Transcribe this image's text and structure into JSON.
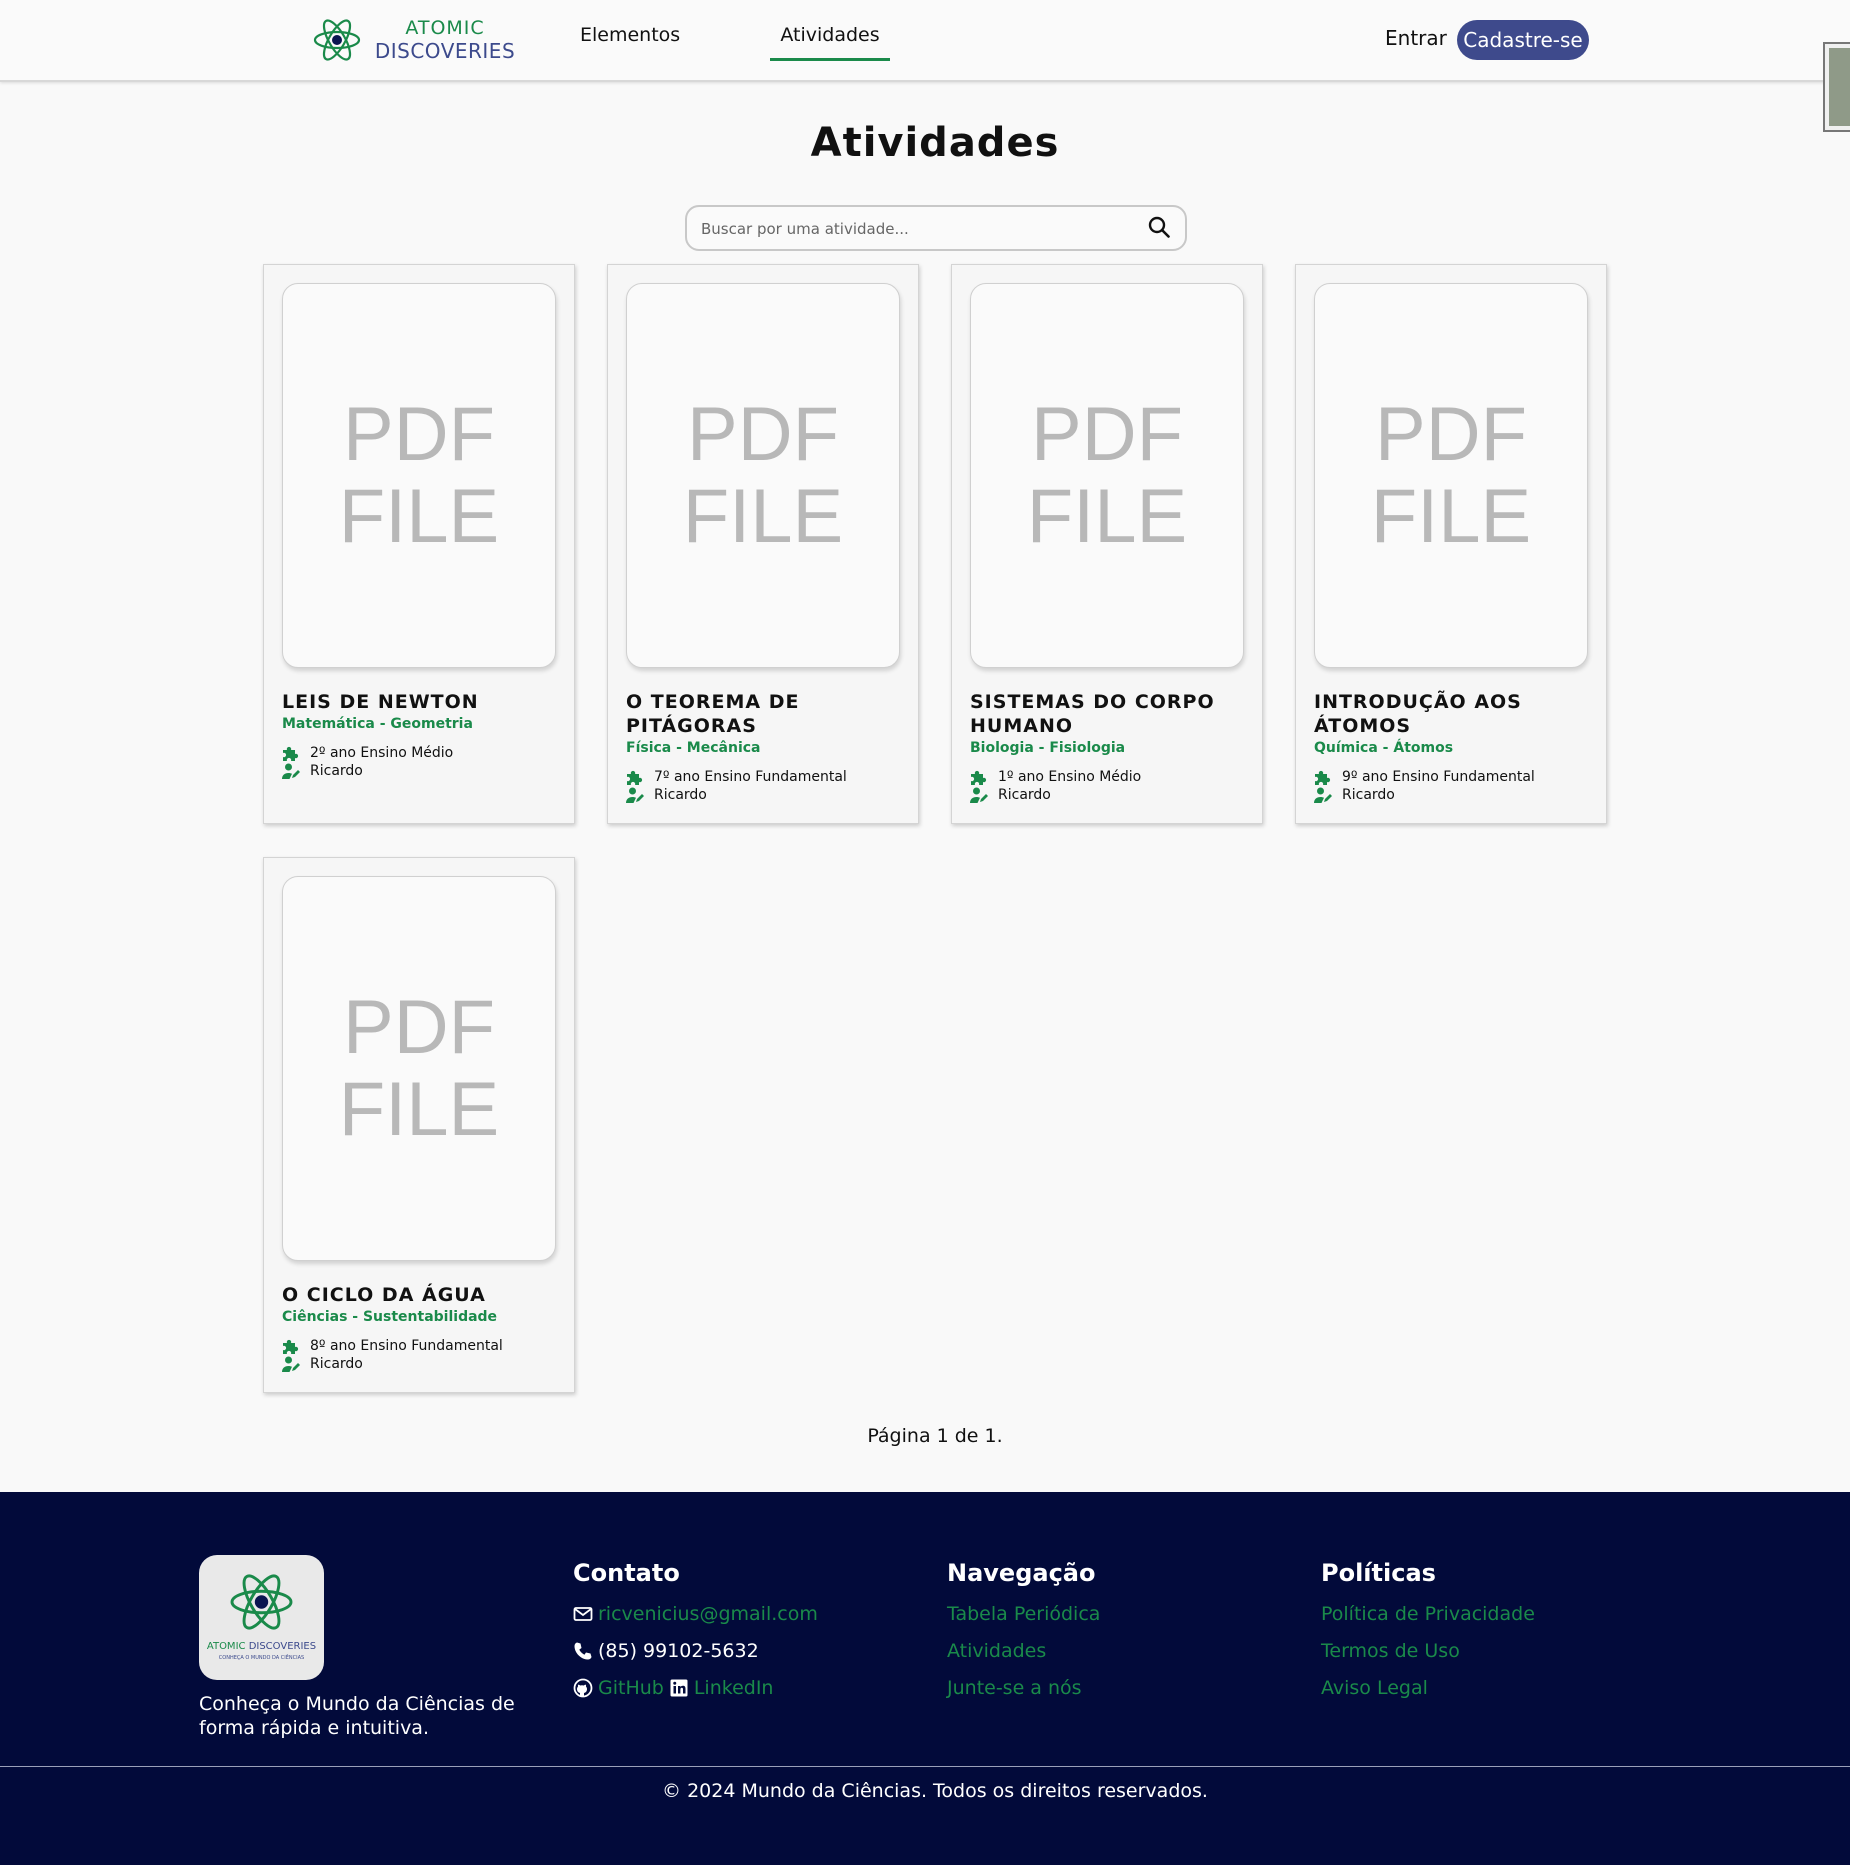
{
  "header": {
    "logo_line1": "ATOMIC",
    "logo_line2": "DISCOVERIES",
    "nav": [
      "Elementos",
      "Atividades"
    ],
    "login_label": "Entrar",
    "signup_label": "Cadastre-se"
  },
  "page": {
    "title": "Atividades",
    "search_placeholder": "Buscar por uma atividade...",
    "pagination": "Página 1 de 1."
  },
  "cards": [
    {
      "thumb_line1": "PDF",
      "thumb_line2": "FILE",
      "title": "LEIS DE NEWTON",
      "subject": "Matemática - Geometria",
      "grade": "2º ano Ensino Médio",
      "author": "Ricardo"
    },
    {
      "thumb_line1": "PDF",
      "thumb_line2": "FILE",
      "title": "O TEOREMA DE PITÁGORAS",
      "subject": "Física - Mecânica",
      "grade": "7º ano Ensino Fundamental",
      "author": "Ricardo"
    },
    {
      "thumb_line1": "PDF",
      "thumb_line2": "FILE",
      "title": "SISTEMAS DO CORPO HUMANO",
      "subject": "Biologia - Fisiologia",
      "grade": "1º ano Ensino Médio",
      "author": "Ricardo"
    },
    {
      "thumb_line1": "PDF",
      "thumb_line2": "FILE",
      "title": "INTRODUÇÃO AOS ÁTOMOS",
      "subject": "Química - Átomos",
      "grade": "9º ano Ensino Fundamental",
      "author": "Ricardo"
    },
    {
      "thumb_line1": "PDF",
      "thumb_line2": "FILE",
      "title": "O CICLO DA ÁGUA",
      "subject": "Ciências - Sustentabilidade",
      "grade": "8º ano Ensino Fundamental",
      "author": "Ricardo"
    }
  ],
  "footer": {
    "logo_line1a": "ATOMIC",
    "logo_line1b": "DISCOVERIES",
    "logo_line2": "CONHEÇA O MUNDO DA CIÊNCIAS",
    "tagline": "Conheça o Mundo da Ciências de forma rápida e intuitiva.",
    "contato_title": "Contato",
    "email": "ricvenicius@gmail.com",
    "phone": "(85) 99102-5632",
    "github": "GitHub",
    "linkedin": "LinkedIn",
    "nav_title": "Navegação",
    "nav_links": [
      "Tabela Periódica",
      "Atividades",
      "Junte-se a nós"
    ],
    "pol_title": "Políticas",
    "pol_links": [
      "Política de Privacidade",
      "Termos de Uso",
      "Aviso Legal"
    ],
    "copyright": "© 2024 Mundo da Ciências. Todos os direitos reservados."
  },
  "colors": {
    "accent_green": "#1a8a4a",
    "brand_blue": "#3e4a8c",
    "footer_bg": "#020a3a"
  },
  "icons": [
    "atom-logo-icon",
    "search-icon",
    "puzzle-icon",
    "user-edit-icon",
    "envelope-icon",
    "phone-icon",
    "github-icon",
    "linkedin-icon"
  ]
}
